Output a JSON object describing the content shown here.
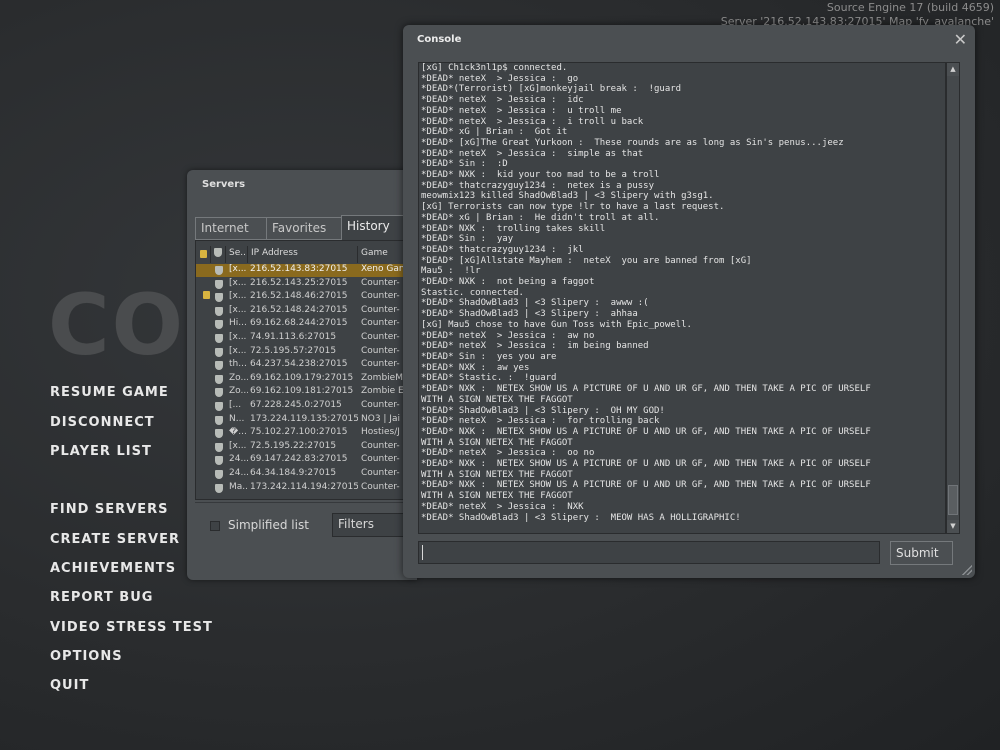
{
  "engine_info": {
    "line1": "Source Engine 17 (build 4659)",
    "line2": "Server '216.52.143.83:27015' Map 'fy_avalanche'"
  },
  "logo_text": "COUNTER-STRIKE",
  "main_menu": [
    "RESUME GAME",
    "DISCONNECT",
    "PLAYER LIST",
    "FIND SERVERS",
    "CREATE SERVER",
    "ACHIEVEMENTS",
    "REPORT BUG",
    "VIDEO STRESS TEST",
    "OPTIONS",
    "QUIT"
  ],
  "servers_window": {
    "title": "Servers",
    "tabs": [
      "Internet",
      "Favorites",
      "History"
    ],
    "active_tab": "History",
    "columns": [
      "Se..",
      "IP Address",
      "Game"
    ],
    "rows": [
      {
        "name": "[x...",
        "ip": "216.52.143.83:27015",
        "game": "Xeno Gan",
        "locked": false,
        "selected": true
      },
      {
        "name": "[x...",
        "ip": "216.52.143.25:27015",
        "game": "Counter-",
        "locked": false,
        "selected": false
      },
      {
        "name": "[x...",
        "ip": "216.52.148.46:27015",
        "game": "Counter-",
        "locked": true,
        "selected": false
      },
      {
        "name": "[x...",
        "ip": "216.52.148.24:27015",
        "game": "Counter-",
        "locked": false,
        "selected": false
      },
      {
        "name": "Hi...",
        "ip": "69.162.68.244:27015",
        "game": "Counter-",
        "locked": false,
        "selected": false
      },
      {
        "name": "[x...",
        "ip": "74.91.113.6:27015",
        "game": "Counter-",
        "locked": false,
        "selected": false
      },
      {
        "name": "[x...",
        "ip": "72.5.195.57:27015",
        "game": "Counter-",
        "locked": false,
        "selected": false
      },
      {
        "name": "th...",
        "ip": "64.237.54.238:27015",
        "game": "Counter-",
        "locked": false,
        "selected": false
      },
      {
        "name": "Zo...",
        "ip": "69.162.109.179:27015",
        "game": "ZombieM",
        "locked": false,
        "selected": false
      },
      {
        "name": "Zo...",
        "ip": "69.162.109.181:27015",
        "game": "Zombie E",
        "locked": false,
        "selected": false
      },
      {
        "name": "[...",
        "ip": "67.228.245.0:27015",
        "game": "Counter-",
        "locked": false,
        "selected": false
      },
      {
        "name": "N...",
        "ip": "173.224.119.135:27015",
        "game": "NO3 | Jai",
        "locked": false,
        "selected": false
      },
      {
        "name": "�...",
        "ip": "75.102.27.100:27015",
        "game": "Hosties/J",
        "locked": false,
        "selected": false
      },
      {
        "name": "[x...",
        "ip": "72.5.195.22:27015",
        "game": "Counter-",
        "locked": false,
        "selected": false
      },
      {
        "name": "24...",
        "ip": "69.147.242.83:27015",
        "game": "Counter-",
        "locked": false,
        "selected": false
      },
      {
        "name": "24...",
        "ip": "64.34.184.9:27015",
        "game": "Counter-",
        "locked": false,
        "selected": false
      },
      {
        "name": "Ma...",
        "ip": "173.242.114.194:27015",
        "game": "Counter-",
        "locked": false,
        "selected": false
      }
    ],
    "simplified_list_label": "Simplified list",
    "filters_label": "Filters"
  },
  "console": {
    "title": "Console",
    "close_glyph": "✕",
    "lines": [
      "[xG] Ch1ck3nl1p$ connected.",
      "*DEAD* neteX  > Jessica :  go",
      "*DEAD*(Terrorist) [xG]monkeyjail break :  !guard",
      "*DEAD* neteX  > Jessica :  idc",
      "*DEAD* neteX  > Jessica :  u troll me",
      "*DEAD* neteX  > Jessica :  i troll u back",
      "*DEAD* xG | Brian :  Got it",
      "*DEAD* [xG]The Great Yurkoon :  These rounds are as long as Sin's penus...jeez",
      "*DEAD* neteX  > Jessica :  simple as that",
      "*DEAD* Sin :  :D",
      "*DEAD* NXK :  kid your too mad to be a troll",
      "*DEAD* thatcrazyguy1234 :  netex is a pussy",
      "meowmix123 killed ShadOwBlad3 | <3 Slipery with g3sg1.",
      "[xG] Terrorists can now type !lr to have a last request.",
      "*DEAD* xG | Brian :  He didn't troll at all.",
      "*DEAD* NXK :  trolling takes skill",
      "*DEAD* Sin :  yay",
      "*DEAD* thatcrazyguy1234 :  jkl",
      "*DEAD* [xG]Allstate Mayhem :  neteX  you are banned from [xG]",
      "Mau5 :  !lr",
      "*DEAD* NXK :  not being a faggot",
      "Stastic. connected.",
      "*DEAD* ShadOwBlad3 | <3 Slipery :  awww :(",
      "*DEAD* ShadOwBlad3 | <3 Slipery :  ahhaa",
      "[xG] Mau5 chose to have Gun Toss with Epic_powell.",
      "*DEAD* neteX  > Jessica :  aw no",
      "*DEAD* neteX  > Jessica :  im being banned",
      "*DEAD* Sin :  yes you are",
      "*DEAD* NXK :  aw yes",
      "*DEAD* Stastic. :  !guard",
      "*DEAD* NXK :  NETEX SHOW US A PICTURE OF U AND UR GF, AND THEN TAKE A PIC OF URSELF",
      "WITH A SIGN NETEX THE FAGGOT",
      "*DEAD* ShadOwBlad3 | <3 Slipery :  OH MY GOD!",
      "*DEAD* neteX  > Jessica :  for trolling back",
      "*DEAD* NXK :  NETEX SHOW US A PICTURE OF U AND UR GF, AND THEN TAKE A PIC OF URSELF",
      "WITH A SIGN NETEX THE FAGGOT",
      "*DEAD* neteX  > Jessica :  oo no",
      "*DEAD* NXK :  NETEX SHOW US A PICTURE OF U AND UR GF, AND THEN TAKE A PIC OF URSELF",
      "WITH A SIGN NETEX THE FAGGOT",
      "*DEAD* NXK :  NETEX SHOW US A PICTURE OF U AND UR GF, AND THEN TAKE A PIC OF URSELF",
      "WITH A SIGN NETEX THE FAGGOT",
      "*DEAD* neteX  > Jessica :  NXK",
      "*DEAD* ShadOwBlad3 | <3 Slipery :  MEOW HAS A HOLLIGRAPHIC!"
    ],
    "input_value": "",
    "submit_label": "Submit",
    "scroll_up_glyph": "▲",
    "scroll_down_glyph": "▼"
  }
}
